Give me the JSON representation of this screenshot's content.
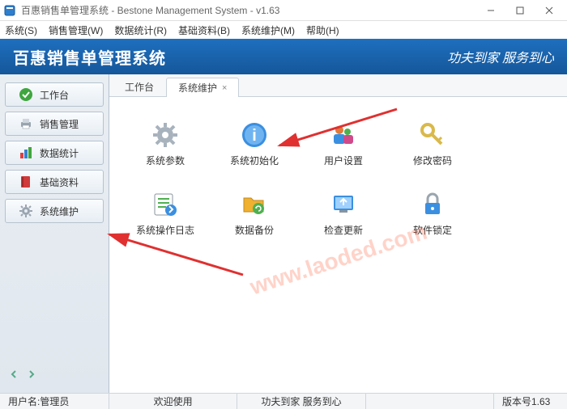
{
  "window": {
    "title": "百惠销售单管理系统 - Bestone Management System - v1.63"
  },
  "menu": {
    "items": [
      "系统(S)",
      "销售管理(W)",
      "数据统计(R)",
      "基础资料(B)",
      "系统维护(M)",
      "帮助(H)"
    ]
  },
  "banner": {
    "system_name": "百惠销售单管理系统",
    "slogan": "功夫到家 服务到心"
  },
  "sidebar": {
    "items": [
      {
        "label": "工作台"
      },
      {
        "label": "销售管理"
      },
      {
        "label": "数据统计"
      },
      {
        "label": "基础资料"
      },
      {
        "label": "系统维护"
      }
    ]
  },
  "tabs": {
    "items": [
      {
        "label": "工作台",
        "active": false
      },
      {
        "label": "系统维护",
        "active": true
      }
    ],
    "close_glyph": "×"
  },
  "apps": {
    "items": [
      {
        "label": "系统参数"
      },
      {
        "label": "系统初始化"
      },
      {
        "label": "用户设置"
      },
      {
        "label": "修改密码"
      },
      {
        "label": "系统操作日志"
      },
      {
        "label": "数据备份"
      },
      {
        "label": "检查更新"
      },
      {
        "label": "软件锁定"
      }
    ]
  },
  "statusbar": {
    "user_label": "用户名:管理员",
    "welcome": "欢迎使用",
    "slogan": "功夫到家 服务到心",
    "version": "版本号1.63"
  },
  "watermark": "www.laoded.com"
}
